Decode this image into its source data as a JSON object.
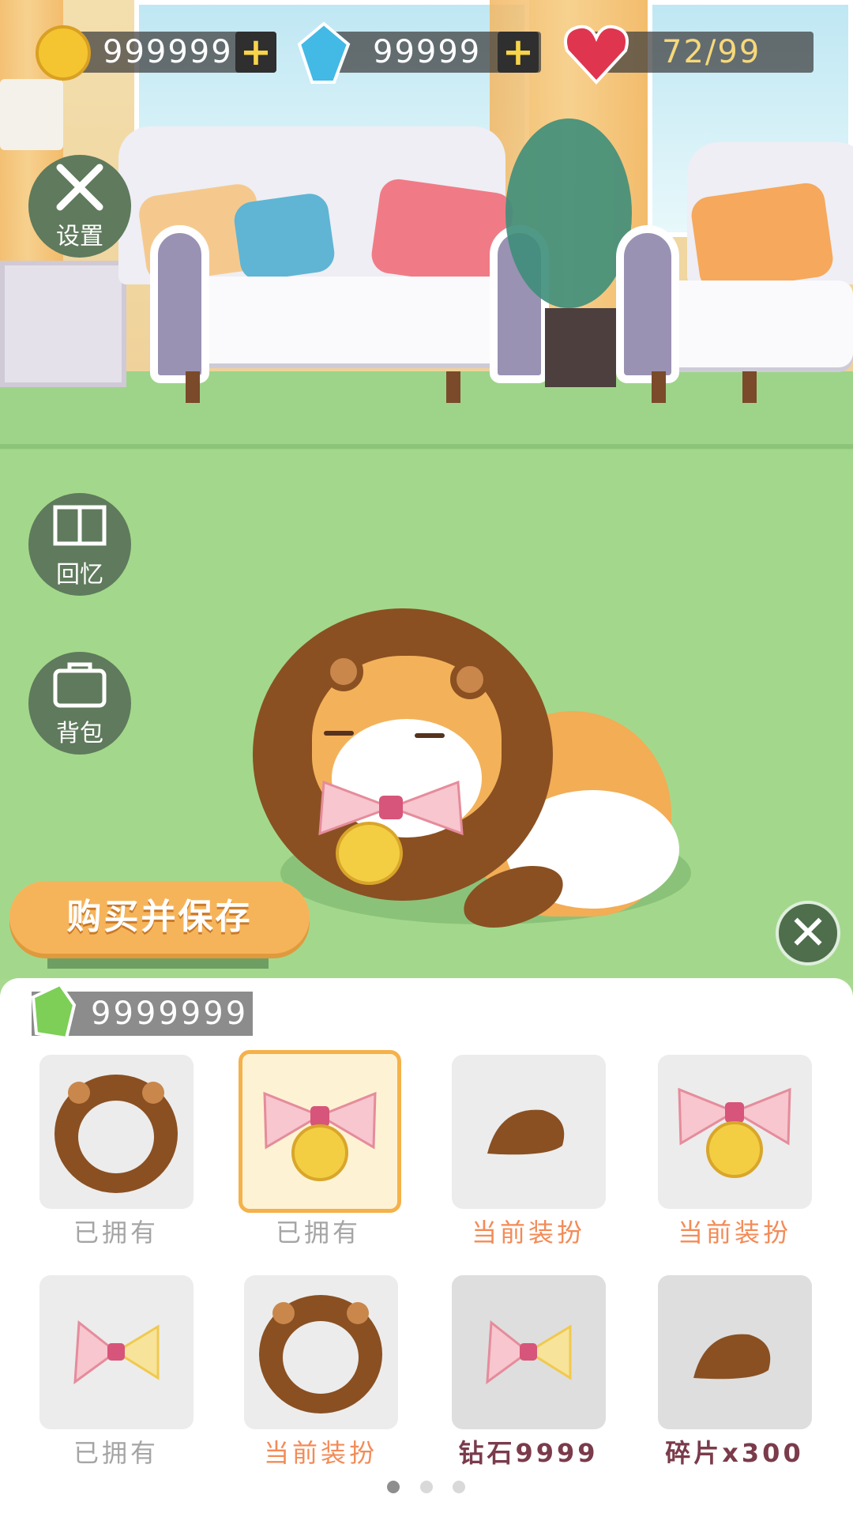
{
  "hud": {
    "coins": "999999",
    "diamonds": "99999",
    "hearts": "72/99"
  },
  "side_buttons": {
    "settings": "设置",
    "memory": "回忆",
    "backpack": "背包"
  },
  "buy_button": "购买并保存",
  "fragments": "9999999",
  "items": [
    {
      "icon": "lion-mane-icon",
      "status": "已拥有",
      "state": "owned"
    },
    {
      "icon": "bow-bell-icon",
      "status": "已拥有",
      "state": "owned",
      "selected": true
    },
    {
      "icon": "lion-tail-icon",
      "status": "当前装扮",
      "state": "current"
    },
    {
      "icon": "bow-bell-icon",
      "status": "当前装扮",
      "state": "current"
    },
    {
      "icon": "bow-icon",
      "status": "已拥有",
      "state": "owned"
    },
    {
      "icon": "lion-mane-icon",
      "status": "当前装扮",
      "state": "current"
    },
    {
      "icon": "bow-icon",
      "status": "钻石9999",
      "state": "price"
    },
    {
      "icon": "lion-tail-icon",
      "status": "碎片x300",
      "state": "price"
    }
  ],
  "pagination": {
    "pages": 3,
    "current": 1
  },
  "colors": {
    "accent": "#f5b14a",
    "current": "#f38b57",
    "price": "#7a3b4b",
    "owned": "#a5a5a5"
  }
}
